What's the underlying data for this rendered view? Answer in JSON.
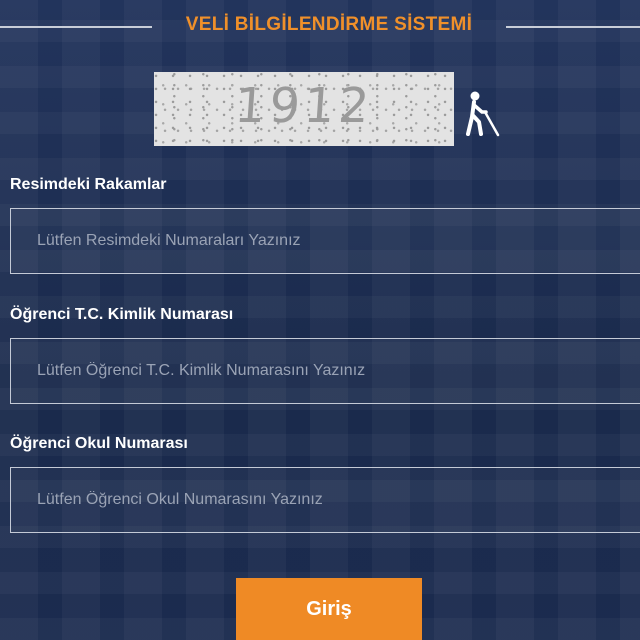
{
  "header": {
    "title": "VELİ BİLGİLENDİRME SİSTEMİ"
  },
  "captcha": {
    "code": "1912",
    "accessibility_icon": "accessibility-icon"
  },
  "fields": [
    {
      "label": "Resimdeki Rakamlar",
      "placeholder": "Lütfen Resimdeki Numaraları Yazınız",
      "value": ""
    },
    {
      "label": "Öğrenci T.C. Kimlik Numarası",
      "placeholder": "Lütfen Öğrenci T.C. Kimlik Numarasını Yazınız",
      "value": ""
    },
    {
      "label": "Öğrenci Okul Numarası",
      "placeholder": "Lütfen Öğrenci Okul Numarasını Yazınız",
      "value": ""
    }
  ],
  "submit": {
    "label": "Giriş"
  },
  "colors": {
    "accent": "#ef8a25",
    "title": "#f0902a",
    "background": "#1c2c50"
  }
}
